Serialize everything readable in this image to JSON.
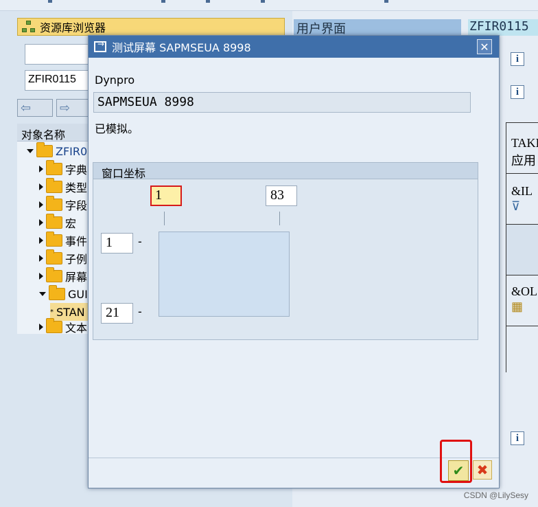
{
  "background": {
    "repo_browser_title": "资源库浏览器",
    "object_input": "ZFIR0115",
    "tree_header": "对象名称",
    "tree_items": [
      {
        "label": "ZFIR0"
      },
      {
        "label": "字典"
      },
      {
        "label": "类型"
      },
      {
        "label": "字段"
      },
      {
        "label": "宏"
      },
      {
        "label": "事件"
      },
      {
        "label": "子例"
      },
      {
        "label": "屏幕"
      },
      {
        "label": "GUI"
      },
      {
        "label": "STAN"
      },
      {
        "label": "文本"
      }
    ],
    "ui_header": "用户界面",
    "program_label": "ZFIR0115",
    "right_texts": [
      "TAKI",
      "应用",
      "&IL",
      "&OL"
    ]
  },
  "dialog": {
    "title": "测试屏幕 SAPMSEUA 8998",
    "dynpro_label": "Dynpro",
    "dynpro_value": "SAPMSEUA 8998",
    "status": "已模拟。",
    "group_title": "窗口坐标",
    "coords": {
      "start_col": "1",
      "end_col": "83",
      "start_row": "1",
      "end_row": "21"
    },
    "dash": "-"
  },
  "buttons": {
    "ok": "✔",
    "cancel": "✖"
  },
  "watermark": "CSDN @LilySesy",
  "icons": {
    "info": "i",
    "close": "✕"
  }
}
